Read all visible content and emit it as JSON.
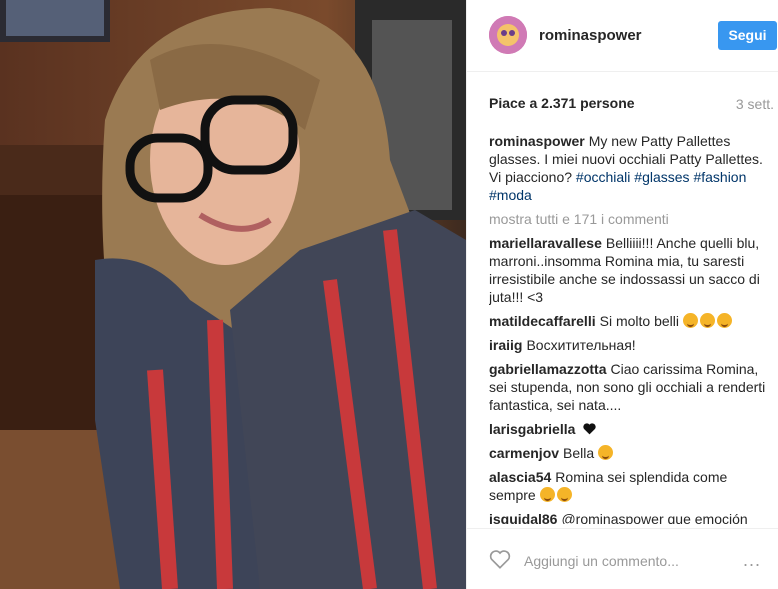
{
  "post": {
    "username": "rominaspower",
    "follow_label": "Segui",
    "likes": "Piace a 2.371 persone",
    "time": "3 sett.",
    "caption": {
      "user": "rominaspower",
      "text": "My new Patty Pallettes glasses. I miei nuovi occhiali Patty Pallettes. Vi piacciono?",
      "hashtags": [
        "#occhiali",
        "#glasses",
        "#fashion",
        "#moda"
      ]
    },
    "show_all_comments": "mostra tutti e 171 i commenti",
    "comments": [
      {
        "user": "mariellaravallese",
        "text": "Belliiii!!! Anche quelli blu, marroni..insomma Romina mia, tu saresti irresistibile anche se indossassi un sacco di juta!!! <3"
      },
      {
        "user": "matildecaffarelli",
        "text": "Si molto belli"
      },
      {
        "user": "iraiig",
        "text": "Восхитительная!"
      },
      {
        "user": "gabriellamazzotta",
        "text": "Ciao carissima Romina, sei stupenda, non sono gli occhiali a renderti fantastica, sei nata...."
      },
      {
        "user": "larisgabriella",
        "text": ""
      },
      {
        "user": "carmenjov",
        "text": "Bella"
      },
      {
        "user": "alascia54",
        "text": "Romina sei splendida come sempre"
      },
      {
        "user": "isquidal86",
        "text": "@rominaspower que emoción"
      }
    ],
    "add_comment_placeholder": "Aggiungi un commento...",
    "more_options": "..."
  },
  "colors": {
    "accent": "#3897f0",
    "hashtag": "#003569",
    "muted": "#999999"
  },
  "icons": {
    "like": "heart-outline-icon",
    "more": "more-options-icon",
    "emoji": "smiley-emoji-icon",
    "heart": "heart-icon"
  }
}
